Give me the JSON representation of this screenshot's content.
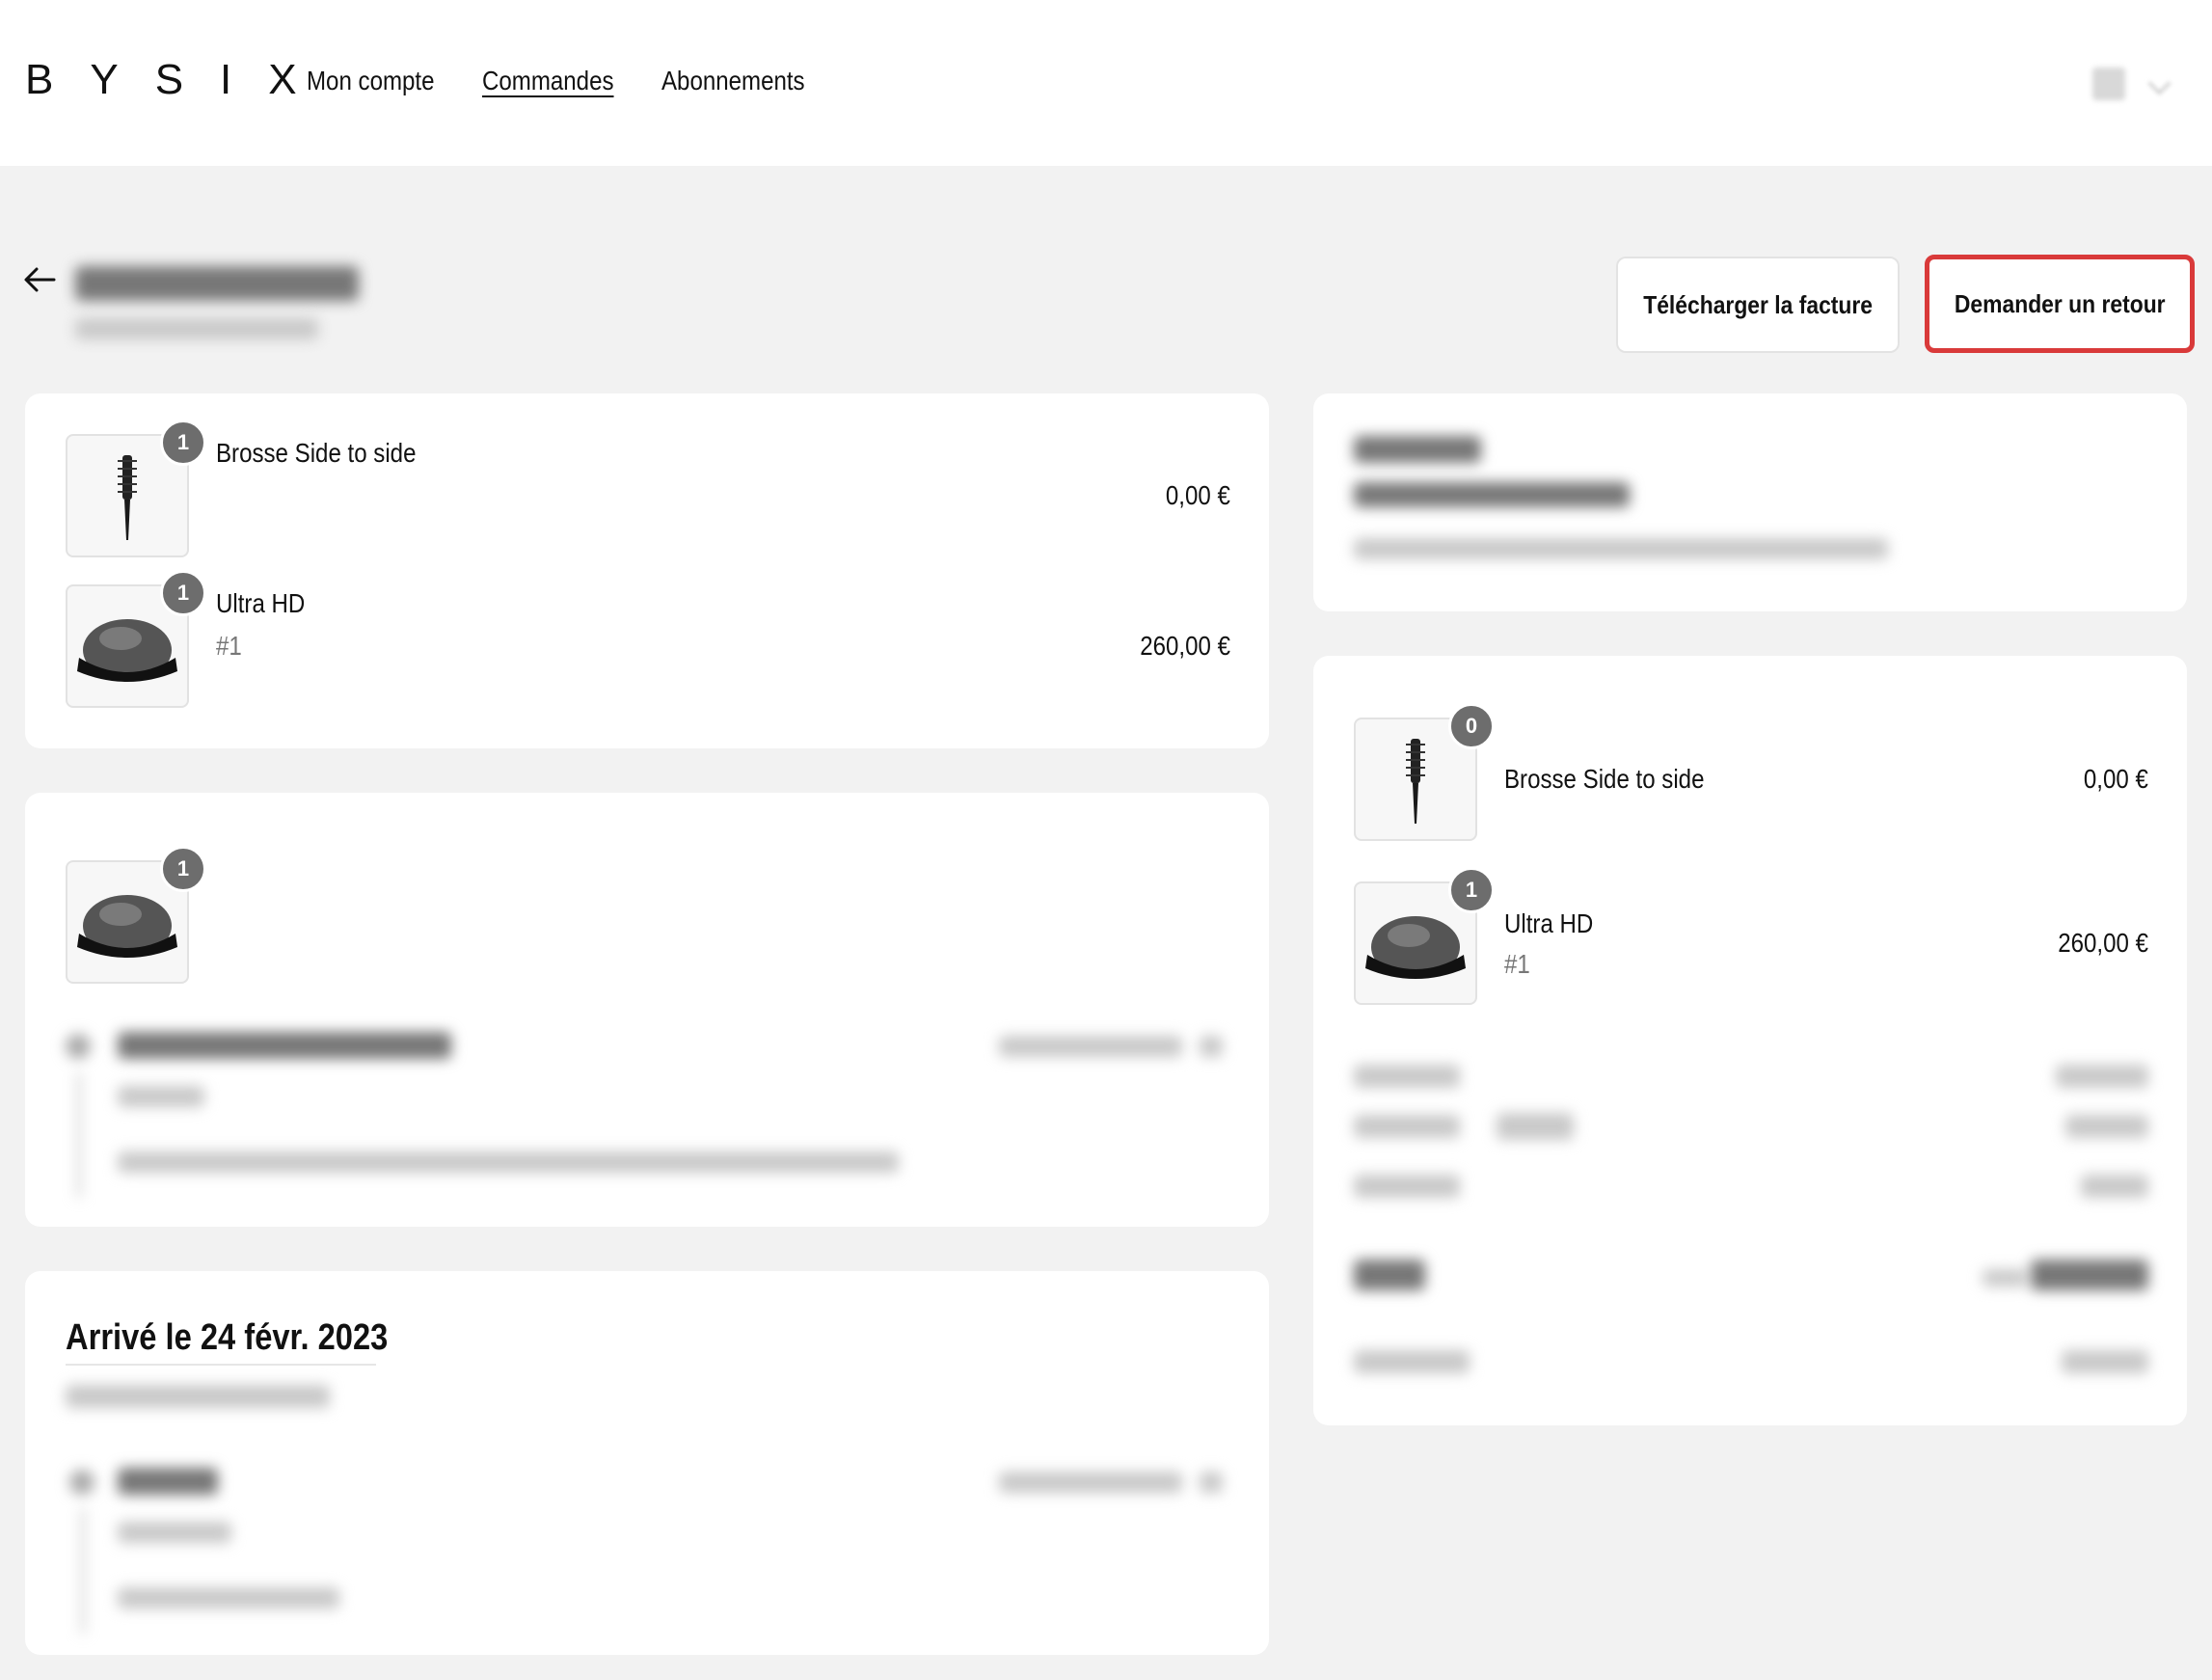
{
  "header": {
    "logo": "BYSIX",
    "nav": [
      {
        "label": "Mon compte",
        "active": false
      },
      {
        "label": "Commandes",
        "active": true
      },
      {
        "label": "Abonnements",
        "active": false
      }
    ]
  },
  "actions": {
    "invoice_label": "Télécharger la facture",
    "return_label": "Demander un retour"
  },
  "order_items": [
    {
      "name": "Brosse Side to side",
      "variant": "",
      "qty": "1",
      "price": "0,00 €"
    },
    {
      "name": "Ultra HD",
      "variant": "#1",
      "qty": "1",
      "price": "260,00 €"
    }
  ],
  "shipment_return": {
    "qty": "1"
  },
  "delivery": {
    "title": "Arrivé le 24 févr. 2023"
  },
  "summary_items": [
    {
      "name": "Brosse Side to side",
      "variant": "",
      "qty": "0",
      "price": "0,00 €"
    },
    {
      "name": "Ultra HD",
      "variant": "#1",
      "qty": "1",
      "price": "260,00 €"
    }
  ],
  "colors": {
    "background": "#f2f2f2",
    "card": "#ffffff",
    "badge": "#6d6d6d",
    "highlight": "#d93a3a"
  },
  "icons": {
    "back": "arrow-left-icon",
    "account_chevron": "chevron-down-icon"
  }
}
